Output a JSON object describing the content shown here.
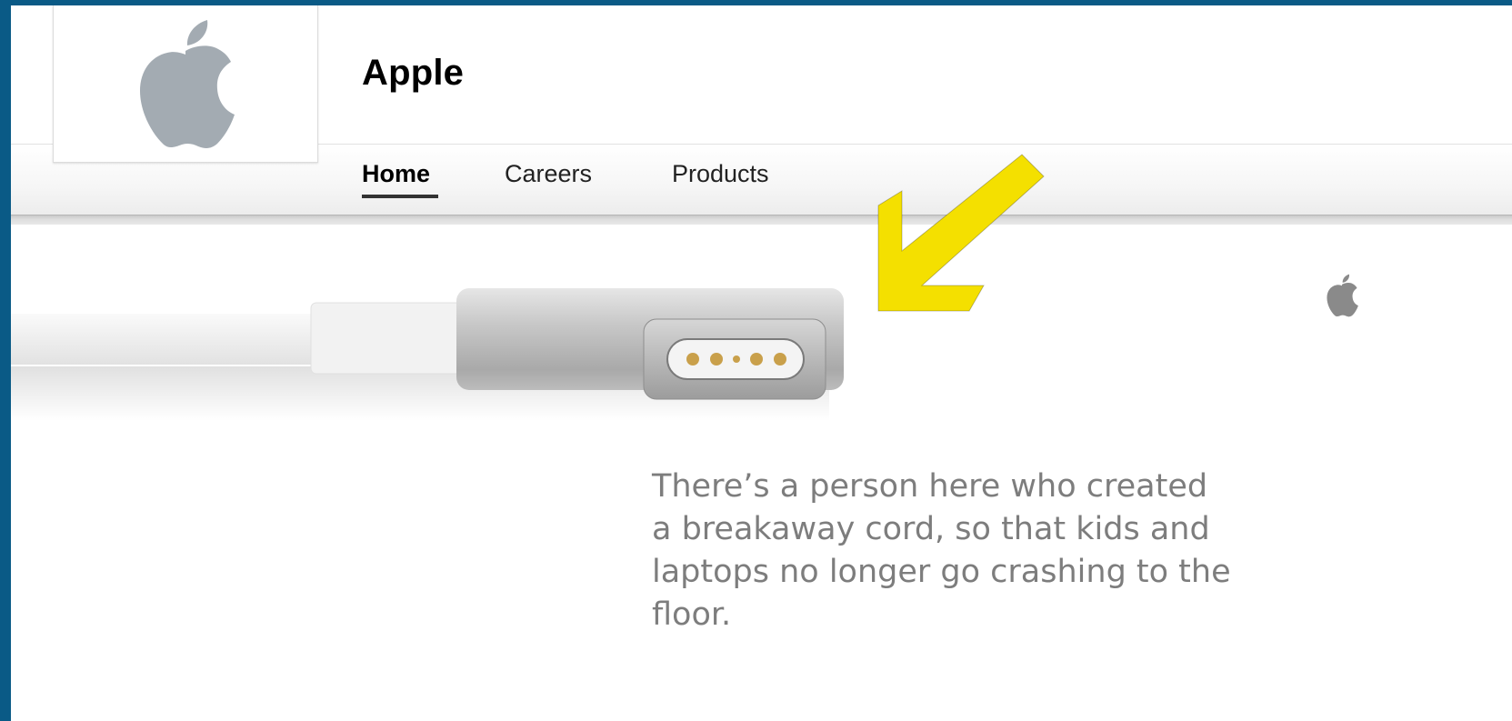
{
  "company": {
    "name": "Apple"
  },
  "nav": {
    "tabs": [
      {
        "label": "Home",
        "active": true
      },
      {
        "label": "Careers",
        "active": false
      },
      {
        "label": "Products",
        "active": false
      }
    ]
  },
  "hero": {
    "caption": "There’s a person here who created a breakaway cord, so that kids and laptops no longer go crashing to the floor."
  },
  "icons": {
    "logo": "apple-logo-icon",
    "annotation": "arrow-annotation-icon"
  },
  "colors": {
    "background": "#0a5a86",
    "annotation_arrow": "#f4e000",
    "logo_gray": "#a3abb2",
    "caption_text": "#7d7d7d"
  }
}
